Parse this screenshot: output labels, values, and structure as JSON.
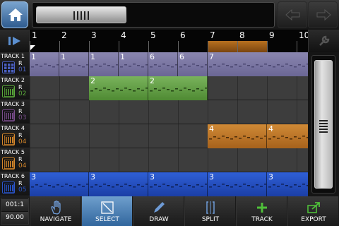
{
  "header": {
    "home_icon": "home-icon",
    "undo_icon": "undo-arrow-icon",
    "redo_icon": "redo-arrow-icon"
  },
  "timeline": {
    "play_icon": "play-icon",
    "settings_icon": "wrench-icon",
    "bars": [
      "1",
      "2",
      "3",
      "4",
      "5",
      "6",
      "7",
      "8",
      "9",
      "10"
    ],
    "loop_color": "#b8701f"
  },
  "tracks": [
    {
      "name": "TRACK 1",
      "r_label": "R",
      "number": "01",
      "icon": "drum-pads-icon",
      "color": "#4a5fbf"
    },
    {
      "name": "TRACK 2",
      "r_label": "R",
      "number": "02",
      "icon": "keyboard-icon",
      "color": "#5aa83a"
    },
    {
      "name": "TRACK 3",
      "r_label": "R",
      "number": "03",
      "icon": "keyboard-icon",
      "color": "#7a4d8c"
    },
    {
      "name": "TRACK 4",
      "r_label": "R",
      "number": "04",
      "icon": "keyboard-icon",
      "color": "#d4862a"
    },
    {
      "name": "TRACK 5",
      "r_label": "R",
      "number": "04",
      "icon": "keyboard-icon",
      "color": "#d4862a"
    },
    {
      "name": "TRACK 6",
      "r_label": "R",
      "number": "05",
      "icon": "keyboard-icon",
      "color": "#2a55cc"
    }
  ],
  "regions": {
    "track1": [
      "1",
      "1",
      "1",
      "1",
      "6",
      "6",
      "7"
    ],
    "track2": [
      "2",
      "2"
    ],
    "track4": [
      "4",
      "4"
    ],
    "track6": [
      "3",
      "3",
      "3",
      "3",
      "3"
    ]
  },
  "counter": {
    "position": "001:1",
    "tempo": "90.00"
  },
  "toolbar": [
    {
      "label": "NAVIGATE",
      "icon": "hand-icon",
      "active": false
    },
    {
      "label": "SELECT",
      "icon": "select-box-icon",
      "active": true
    },
    {
      "label": "DRAW",
      "icon": "pencil-icon",
      "active": false
    },
    {
      "label": "SPLIT",
      "icon": "split-icon",
      "active": false
    },
    {
      "label": "TRACK",
      "icon": "plus-icon",
      "active": false
    },
    {
      "label": "EXPORT",
      "icon": "export-icon",
      "active": false
    }
  ]
}
